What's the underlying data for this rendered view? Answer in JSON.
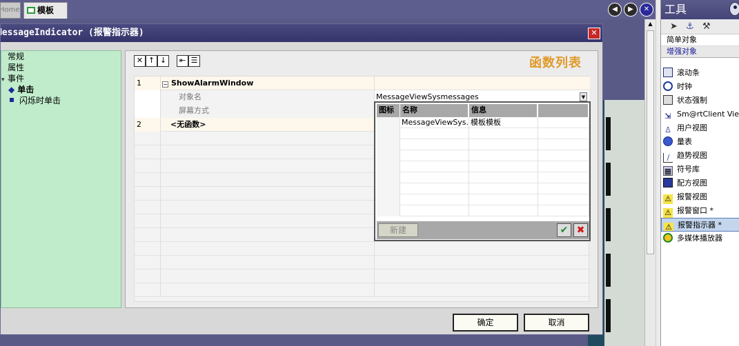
{
  "tabs": {
    "home_label": "Home",
    "template_label": "模板"
  },
  "nav": {
    "prev_glyph": "◀",
    "next_glyph": "▶",
    "close_glyph": "✕"
  },
  "dialog": {
    "title": "MessageIndicator (报警指示器)",
    "close_glyph": "✕",
    "tree": {
      "items": [
        {
          "label": "常规"
        },
        {
          "label": "属性"
        },
        {
          "label": "事件",
          "expand": "▾"
        },
        {
          "label": "单击",
          "icon": "◆"
        },
        {
          "label": "闪烁时单击"
        }
      ]
    },
    "toolbar": {
      "delete": "✕",
      "up": "↑",
      "down": "↓",
      "indent": "⇤",
      "list": "☰"
    },
    "function_list_title": "函数列表",
    "rows": [
      {
        "num": "1",
        "name": "ShowAlarmWindow",
        "collapse": "−"
      },
      {
        "param_label": "对象名",
        "value": "MessageViewSysmessages",
        "drop": "▼"
      },
      {
        "param_label": "屏幕方式",
        "value": ""
      },
      {
        "num": "2",
        "name": "<无函数>"
      }
    ],
    "popup": {
      "headers": [
        "图标",
        "名称",
        "信息",
        ""
      ],
      "row": {
        "icon": "",
        "name": "MessageViewSys...",
        "info": "模板模板"
      },
      "new_button": "新建",
      "ok_glyph": "✔",
      "cancel_glyph": "✖"
    },
    "ok_button": "确定",
    "cancel_button": "取消"
  },
  "tools": {
    "title": "工具",
    "categories": {
      "simple": "简单对象",
      "enhanced": "增强对象"
    },
    "items": [
      {
        "label": "滚动条",
        "icon": "scroll-bar-icon"
      },
      {
        "label": "时钟",
        "icon": "clock-icon"
      },
      {
        "label": "状态强制",
        "icon": "status-force-icon"
      },
      {
        "label": "Sm@rtClient Vie",
        "icon": "smartclient-view-icon"
      },
      {
        "label": "用户视图",
        "icon": "user-view-icon"
      },
      {
        "label": "量表",
        "icon": "gauge-icon"
      },
      {
        "label": "趋势视图",
        "icon": "trend-view-icon"
      },
      {
        "label": "符号库",
        "icon": "symbol-library-icon"
      },
      {
        "label": "配方视图",
        "icon": "recipe-view-icon"
      },
      {
        "label": "报警视图",
        "icon": "alarm-view-icon"
      },
      {
        "label": "报警窗口 *",
        "icon": "alarm-window-icon"
      },
      {
        "label": "报警指示器 *",
        "icon": "alarm-indicator-icon",
        "selected": true
      },
      {
        "label": "多媒体播放器",
        "icon": "media-player-icon"
      }
    ]
  }
}
